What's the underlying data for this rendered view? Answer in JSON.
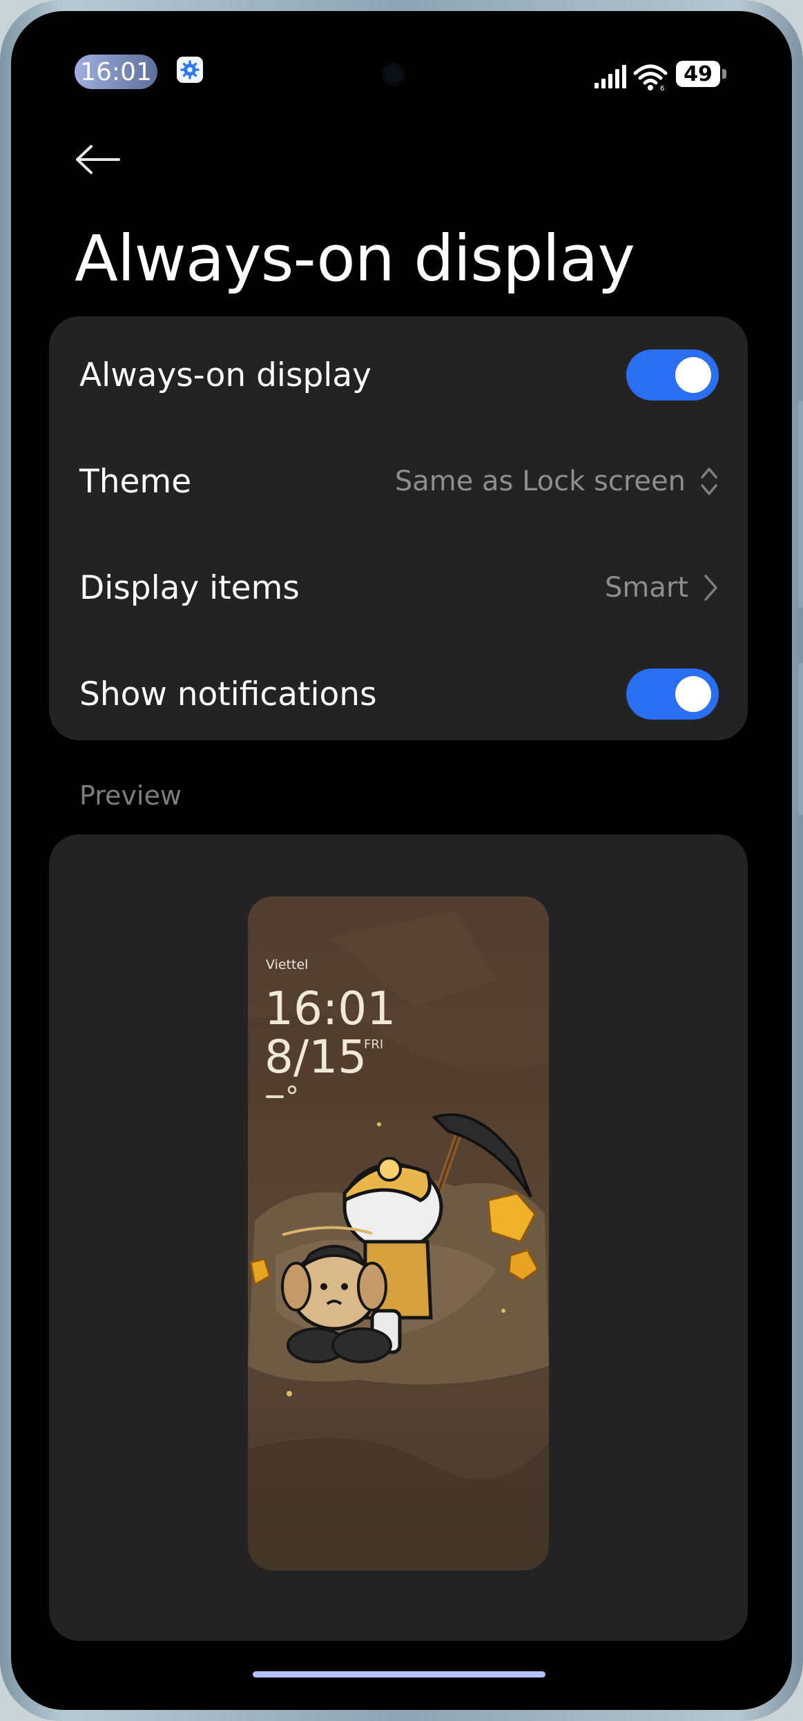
{
  "status_bar": {
    "time": "16:01",
    "battery": "49",
    "icons": [
      "settings-gear-icon",
      "signal-icon",
      "wifi-icon",
      "battery-icon"
    ]
  },
  "header": {
    "back_icon": "back-arrow-icon",
    "title": "Always-on display"
  },
  "settings": {
    "always_on": {
      "label": "Always-on display",
      "enabled": true
    },
    "theme": {
      "label": "Theme",
      "value": "Same as Lock screen",
      "icon": "up-down-chevron-icon"
    },
    "display_items": {
      "label": "Display items",
      "value": "Smart",
      "icon": "chevron-right-icon"
    },
    "show_notifications": {
      "label": "Show notifications",
      "enabled": true
    }
  },
  "preview": {
    "section_label": "Preview",
    "carrier": "Viettel",
    "time": "16:01",
    "date": "8/15",
    "weekday": "FRI"
  },
  "colors": {
    "accent": "#2a6ff1",
    "background": "#000000",
    "card": "#232323",
    "secondary_text": "#8e8e8e"
  }
}
